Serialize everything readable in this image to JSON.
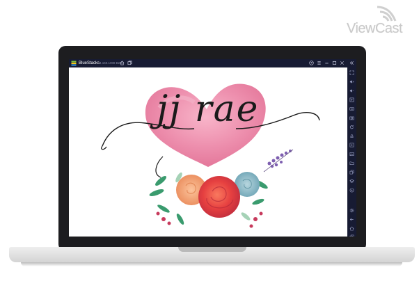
{
  "watermark": {
    "text": "ViewCast"
  },
  "titlebar": {
    "app_name": "BlueStacks",
    "version": "4.150.1008 Beta"
  },
  "canvas": {
    "logo_text": "jj rae"
  },
  "colors": {
    "titlebar_bg": "#171b33",
    "sidebar_bg": "#171b33",
    "heart": "#e9779a",
    "rose": "#e84f4f",
    "leaf": "#3a9b6e"
  }
}
